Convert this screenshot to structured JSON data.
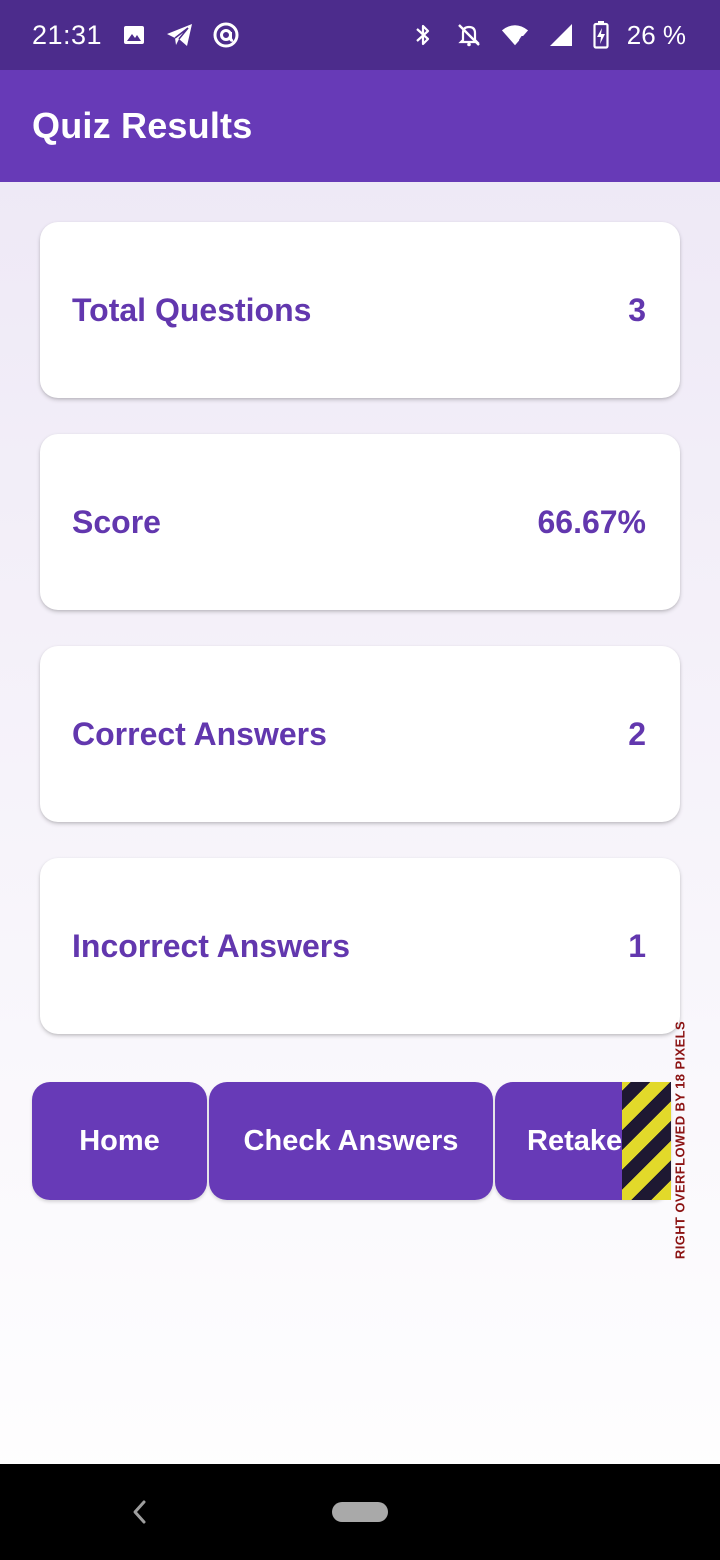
{
  "status_bar": {
    "time": "21:31",
    "battery": "26 %",
    "icons": [
      "image-icon",
      "telegram-icon",
      "at-sign-icon",
      "bluetooth-icon",
      "notifications-off-icon",
      "wifi-icon",
      "signal-icon",
      "battery-charging-icon"
    ]
  },
  "app_bar": {
    "title": "Quiz Results"
  },
  "results": [
    {
      "label": "Total Questions",
      "value": "3"
    },
    {
      "label": "Score",
      "value": "66.67%"
    },
    {
      "label": "Correct Answers",
      "value": "2"
    },
    {
      "label": "Incorrect Answers",
      "value": "1"
    }
  ],
  "buttons": {
    "home": "Home",
    "check_answers": "Check Answers",
    "retake": "Retake Quiz"
  },
  "overflow_warning": "RIGHT OVERFLOWED BY 18 PIXELS",
  "colors": {
    "status_bar": "#4c2c8c",
    "primary": "#673ab7",
    "text_accent": "#6237ae",
    "overflow_yellow": "#e2d92a"
  }
}
